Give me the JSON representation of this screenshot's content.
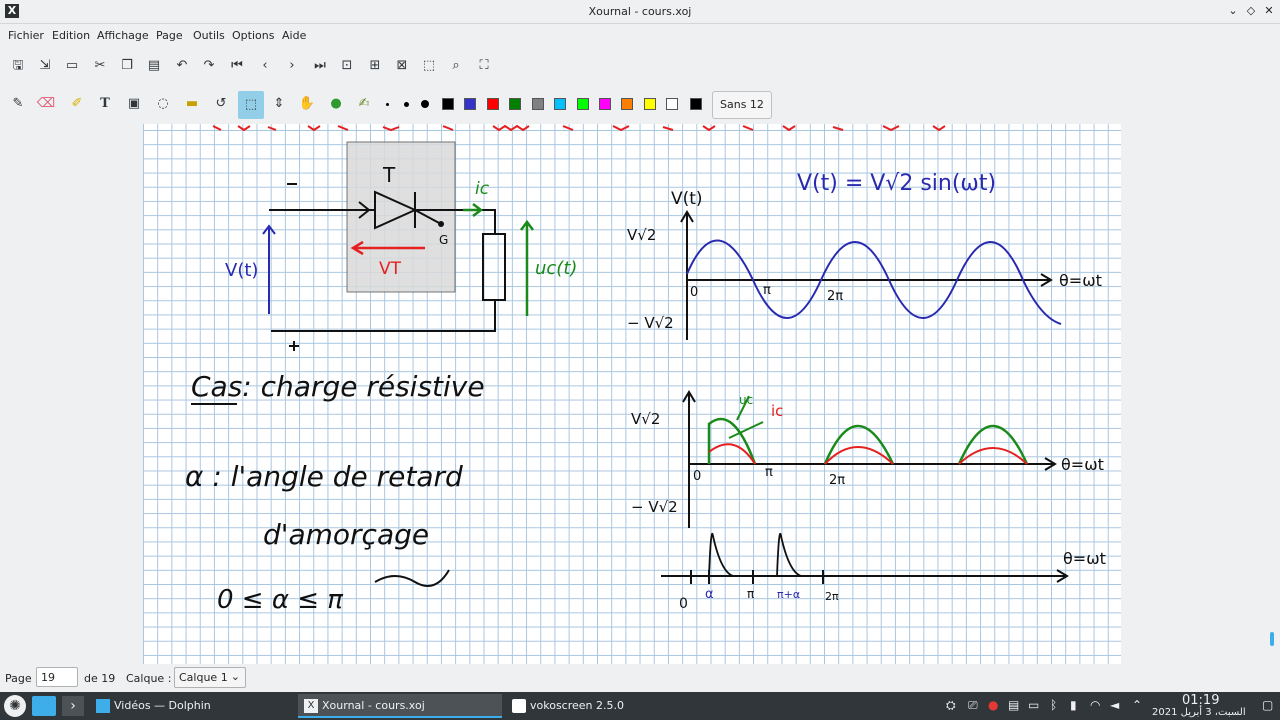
{
  "window": {
    "title": "Xournal - cours.xoj"
  },
  "menu": [
    "Fichier",
    "Edition",
    "Affichage",
    "Page",
    "Outils",
    "Options",
    "Aide"
  ],
  "toolbar": {
    "file_icons": [
      "save-icon",
      "export-pdf-icon",
      "open-icon",
      "cut-icon",
      "copy-icon",
      "paste-icon",
      "undo-icon",
      "redo-icon",
      "first-page-icon",
      "previous-page-icon",
      "next-page-icon",
      "last-page-icon",
      "zoom-fit-icon",
      "zoom-width-icon",
      "zoom-height-icon",
      "zoom-page-icon",
      "zoom-icon",
      "fullscreen-icon"
    ],
    "font_button": "Sans  12",
    "colors": [
      "#000000",
      "#3333cc",
      "#ff0000",
      "#008000",
      "#808080",
      "#00c0ff",
      "#00ff00",
      "#ff00ff",
      "#ff8000",
      "#ffff00",
      "#ffffff",
      "#000000"
    ]
  },
  "canvas": {
    "circuit": {
      "label_T": "T",
      "label_G": "G",
      "label_ic": "ic",
      "label_vt": "V(t)",
      "label_VT": "VT",
      "label_uc": "uc(t)",
      "minus": "−",
      "plus": "+"
    },
    "notes": {
      "cas": "Cas: charge résistive",
      "alpha_line": "α : l'angle de retard",
      "amorcage": "d'amorçage",
      "range": "0 ≤ α ≤ π"
    },
    "graph1": {
      "equation": "V(t) = V√2 sin(ωt)",
      "ylabel": "V(t)",
      "vmax": "V√2",
      "vmin": "− V√2",
      "origin": "0",
      "pi": "π",
      "two_pi": "2π",
      "theta": "θ=ωt"
    },
    "graph2": {
      "vmax": "V√2",
      "vmin": "− V√2",
      "origin": "0",
      "pi": "π",
      "two_pi": "2π",
      "theta": "θ=ωt",
      "uc": "uc",
      "ic": "ic"
    },
    "graph3": {
      "theta": "θ=ωt",
      "origin": "0",
      "alpha": "α",
      "pi": "π",
      "pi_alpha": "π+α",
      "two_pi": "2π"
    }
  },
  "status": {
    "page_label": "Page",
    "page_value": "19",
    "of_label": "de 19",
    "layer_label": "Calque :",
    "layer_value": "Calque 1"
  },
  "taskbar": {
    "tasks": [
      "Vidéos — Dolphin",
      "Xournal - cours.xoj",
      "vokoscreen 2.5.0"
    ],
    "time": "01:19",
    "date": "السبت، 3 أبريل 2021"
  }
}
